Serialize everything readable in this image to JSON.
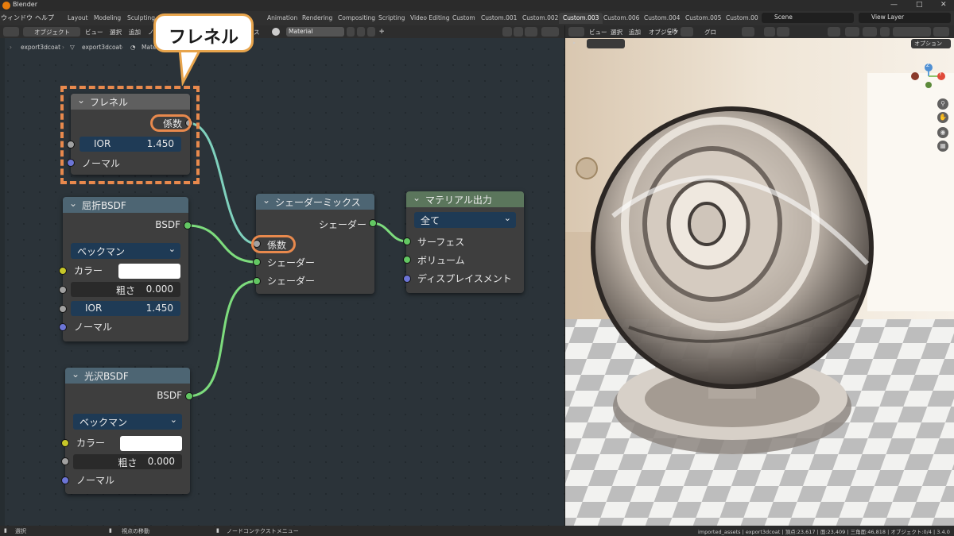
{
  "app": {
    "title": "Blender"
  },
  "menu": {
    "items": [
      "ウィンドウ",
      "ヘルプ"
    ]
  },
  "workspace_tabs": [
    "Layout",
    "Modeling",
    "Sculpting",
    "Animation",
    "Rendering",
    "Compositing",
    "Scripting",
    "Video Editing",
    "Custom",
    "Custom.001",
    "Custom.002",
    "Custom.003",
    "Custom.006",
    "Custom.004",
    "Custom.005",
    "Custom.00"
  ],
  "active_tab": "Custom.003",
  "scene": {
    "label": "Scene",
    "view_layer": "View Layer"
  },
  "node_editor_header": {
    "mode": "オブジェクト",
    "items": [
      "ビュー",
      "選択",
      "追加",
      "ノ"
    ],
    "slot_label": "ス",
    "material": "Material"
  },
  "breadcrumb": [
    "export3dcoat",
    "export3dcoat",
    "Materi"
  ],
  "viewport_header": {
    "items": [
      "ビュー",
      "選択",
      "追加",
      "オブジェクト",
      "GIS"
    ],
    "transform": "グロ",
    "options": "オプション"
  },
  "annotation": {
    "callout": "フレネル"
  },
  "nodes": {
    "fresnel": {
      "title": "フレネル",
      "output": "係数",
      "ior_label": "IOR",
      "ior_value": "1.450",
      "normal": "ノーマル"
    },
    "refraction": {
      "title": "屈折BSDF",
      "output": "BSDF",
      "distribution": "ベックマン",
      "color_label": "カラー",
      "roughness_label": "粗さ",
      "roughness_value": "0.000",
      "ior_label": "IOR",
      "ior_value": "1.450",
      "normal": "ノーマル"
    },
    "glossy": {
      "title": "光沢BSDF",
      "output": "BSDF",
      "distribution": "ベックマン",
      "color_label": "カラー",
      "roughness_label": "粗さ",
      "roughness_value": "0.000",
      "normal": "ノーマル"
    },
    "mix": {
      "title": "シェーダーミックス",
      "output": "シェーダー",
      "fac": "係数",
      "shader1": "シェーダー",
      "shader2": "シェーダー"
    },
    "output": {
      "title": "マテリアル出力",
      "target": "全て",
      "surface": "サーフェス",
      "volume": "ボリューム",
      "displacement": "ディスプレイスメント"
    }
  },
  "gizmo": {
    "z": "Z",
    "y": "Y"
  },
  "status": {
    "select": "選択",
    "move_view": "視点の移動",
    "context_menu": "ノードコンテクストメニュー",
    "stats": "imported_assets | export3dcoat | 頂点:23,617 | 面:23,409 | 三角面:46,818 | オブジェクト:0/4 | 3.4.0"
  },
  "colors": {
    "socket_float": "#a1a1a1",
    "socket_shader": "#63c763",
    "socket_color": "#c7c729",
    "socket_vector": "#6c75d6",
    "annotation": "#e8894d",
    "callout_border": "#e8a54d"
  }
}
